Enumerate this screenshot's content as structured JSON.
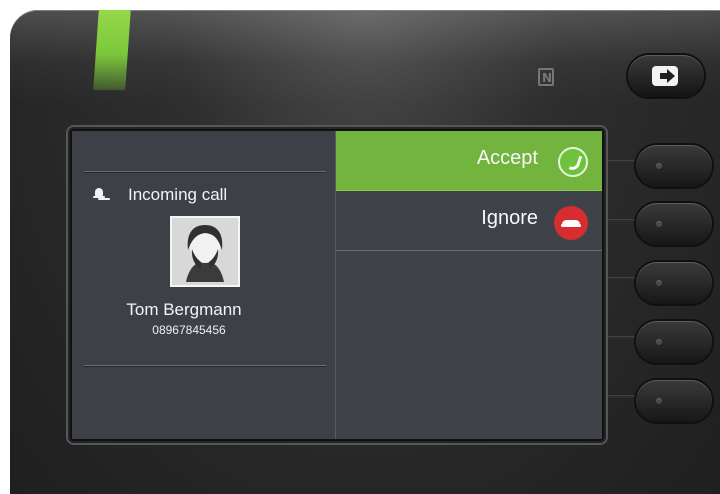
{
  "call": {
    "status_label": "Incoming call",
    "caller_name": "Tom Bergmann",
    "caller_number": "08967845456"
  },
  "actions": {
    "accept_label": "Accept",
    "ignore_label": "Ignore"
  },
  "icons": {
    "top_key": "exit-icon",
    "status": "bell-icon",
    "accept": "phone-accept-icon",
    "ignore": "phone-reject-icon",
    "avatar": "person-avatar-icon",
    "nfc": "nfc-icon"
  },
  "colors": {
    "accept_highlight": "#72b43d",
    "accept_icon": "#6ec33d",
    "ignore_icon": "#d62d30",
    "led": "#7bc83b",
    "screen": "#3f4248"
  }
}
